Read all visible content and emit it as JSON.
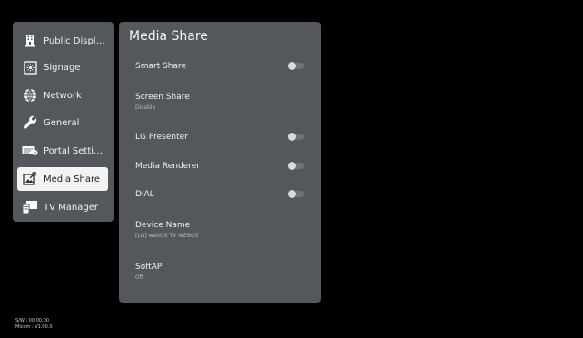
{
  "menu": {
    "items": [
      {
        "label": "Public Display...",
        "icon": "building-icon",
        "selected": false
      },
      {
        "label": "Signage",
        "icon": "signage-icon",
        "selected": false
      },
      {
        "label": "Network",
        "icon": "network-globe-icon",
        "selected": false
      },
      {
        "label": "General",
        "icon": "wrench-icon",
        "selected": false
      },
      {
        "label": "Portal Settings",
        "icon": "portal-settings-icon",
        "selected": false
      },
      {
        "label": "Media Share",
        "icon": "media-share-icon",
        "selected": true
      },
      {
        "label": "TV Manager",
        "icon": "tv-manager-icon",
        "selected": false
      }
    ]
  },
  "panel": {
    "title": "Media Share",
    "rows": [
      {
        "label": "Smart Share",
        "toggle": false
      },
      {
        "label": "Screen Share",
        "sub": "Disable"
      },
      {
        "label": "LG Presenter",
        "toggle": false
      },
      {
        "label": "Media Renderer",
        "toggle": false
      },
      {
        "label": "DIAL",
        "toggle": false
      },
      {
        "label": "Device Name",
        "sub": "[LG] webOS TV WEBOS"
      },
      {
        "label": "SoftAP",
        "sub": "Off"
      }
    ]
  },
  "footer": {
    "sw": "S/W : 00.00.00",
    "micom": "Micom : V1.00.0"
  },
  "colors": {
    "background": "#000000",
    "panel": "#54575b",
    "selected": "#f3f3f3",
    "toggle_track": "#6f7276",
    "toggle_knob": "#d9dadc"
  }
}
